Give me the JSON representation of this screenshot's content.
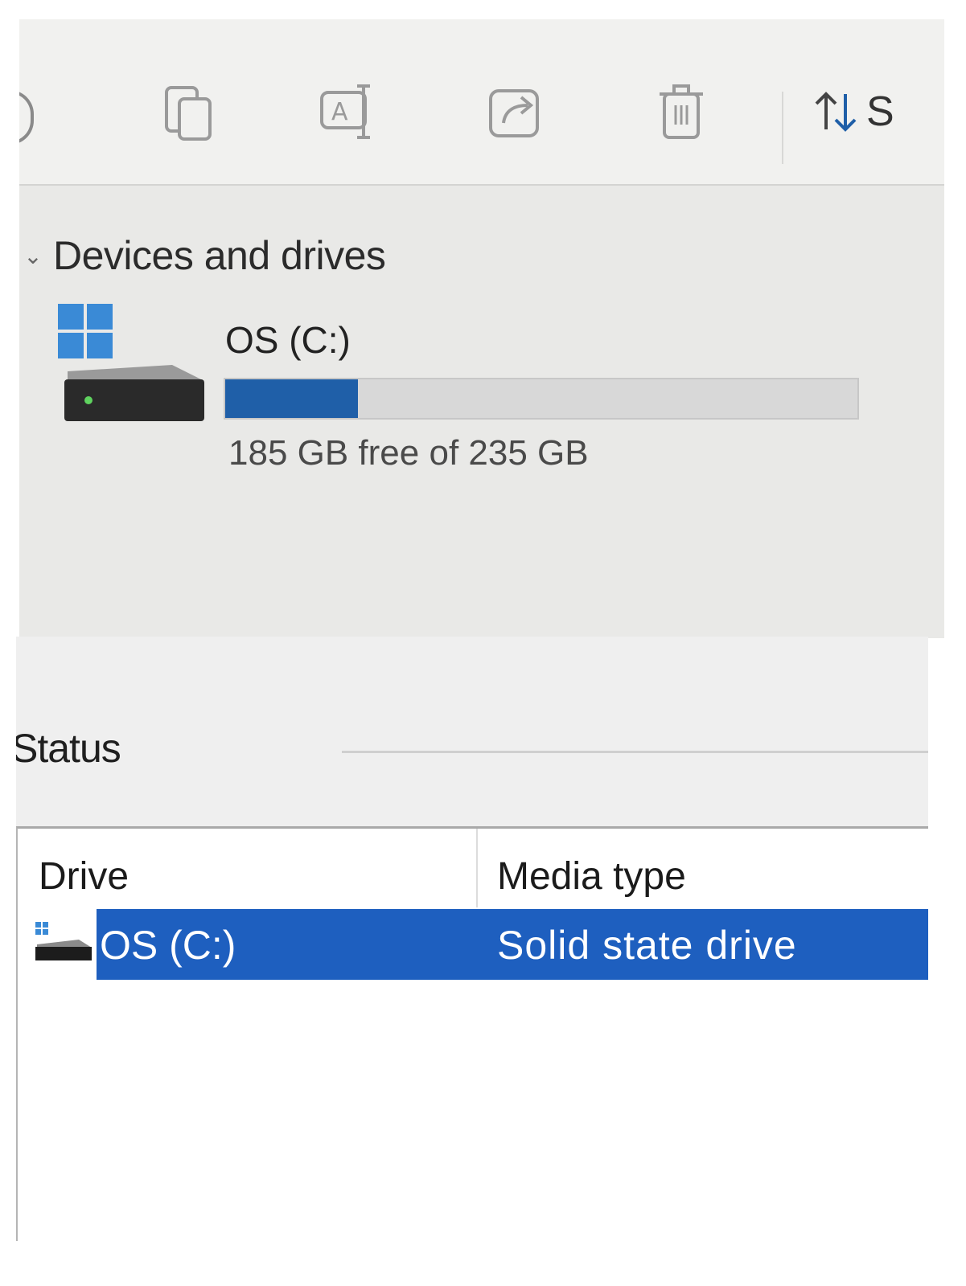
{
  "explorer": {
    "toolbar": {
      "icons": [
        "copy-icon",
        "rename-icon",
        "share-icon",
        "delete-icon"
      ],
      "sort_label": "S"
    },
    "section_title": "Devices and drives",
    "drive": {
      "name": "OS (C:)",
      "space_text": "185 GB free of 235 GB",
      "used_fraction": 0.21,
      "bar_color": "#1f5fa8"
    }
  },
  "optimize": {
    "status_label": "Status",
    "columns": {
      "drive": "Drive",
      "media_type": "Media type"
    },
    "rows": [
      {
        "drive": "OS (C:)",
        "media_type": "Solid state drive",
        "selected": true
      }
    ],
    "selection_color": "#1e5fbf"
  }
}
